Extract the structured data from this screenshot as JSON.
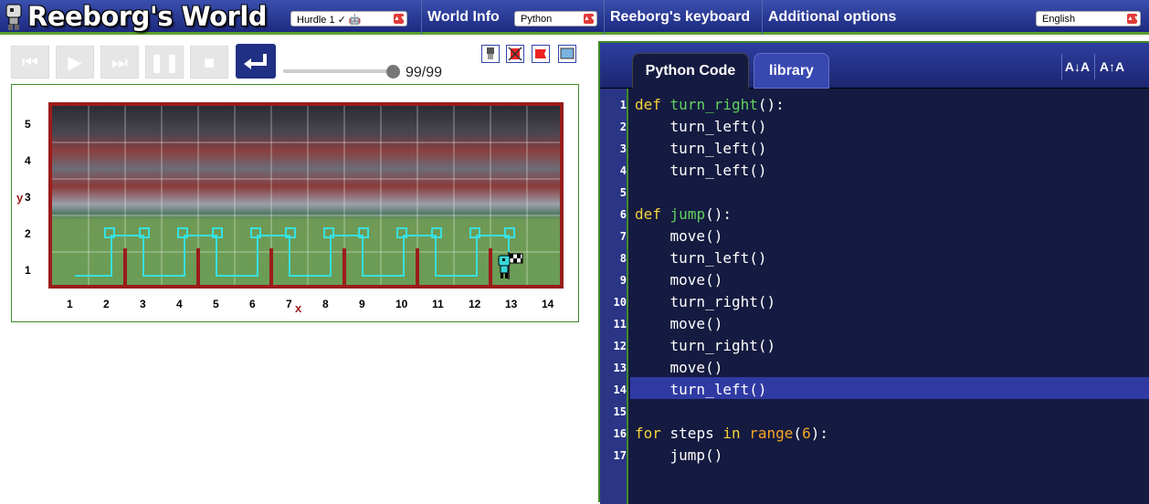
{
  "app": {
    "title": "Reeborg's World"
  },
  "header": {
    "world_select": "Hurdle 1 ✓ 🤖",
    "world_info": "World Info",
    "language_select": "Python",
    "keyboard": "Reeborg's keyboard",
    "additional": "Additional options",
    "ui_language": "English"
  },
  "controls": {
    "progress": "99/99",
    "progress_fraction": 1.0
  },
  "world": {
    "y_label": "y",
    "x_label": "x",
    "y_ticks": [
      "5",
      "4",
      "3",
      "2",
      "1"
    ],
    "x_ticks": [
      "1",
      "2",
      "3",
      "4",
      "5",
      "6",
      "7",
      "8",
      "9",
      "10",
      "11",
      "12",
      "13",
      "14"
    ]
  },
  "editor": {
    "tabs": [
      "Python Code",
      "library"
    ],
    "lines": [
      {
        "n": "1",
        "code": "def turn_right():"
      },
      {
        "n": "2",
        "code": "    turn_left()"
      },
      {
        "n": "3",
        "code": "    turn_left()"
      },
      {
        "n": "4",
        "code": "    turn_left()"
      },
      {
        "n": "5",
        "code": ""
      },
      {
        "n": "6",
        "code": "def jump():"
      },
      {
        "n": "7",
        "code": "    move()"
      },
      {
        "n": "8",
        "code": "    turn_left()"
      },
      {
        "n": "9",
        "code": "    move()"
      },
      {
        "n": "10",
        "code": "    turn_right()"
      },
      {
        "n": "11",
        "code": "    move()"
      },
      {
        "n": "12",
        "code": "    turn_right()"
      },
      {
        "n": "13",
        "code": "    move()"
      },
      {
        "n": "14",
        "code": "    turn_left()"
      },
      {
        "n": "15",
        "code": ""
      },
      {
        "n": "16",
        "code": "for steps in range(6):"
      },
      {
        "n": "17",
        "code": "    jump()"
      }
    ],
    "highlighted_line": "14"
  },
  "colors": {
    "header": "#1d2a80",
    "accent": "#5aa02c",
    "wall": "#9b1c1c",
    "trace": "#37e0e0",
    "editor_bg": "#151a40"
  }
}
